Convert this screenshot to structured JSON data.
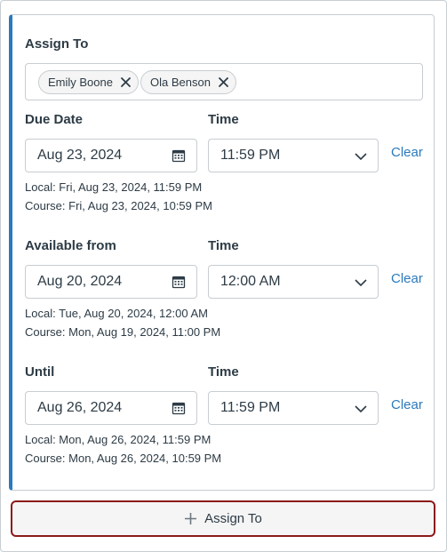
{
  "assign": {
    "label": "Assign To",
    "assignees": [
      {
        "name": "Emily Boone"
      },
      {
        "name": "Ola Benson"
      }
    ]
  },
  "due": {
    "label": "Due Date",
    "time_label": "Time",
    "date": "Aug 23, 2024",
    "time": "11:59 PM",
    "clear": "Clear",
    "local": "Local: Fri, Aug 23, 2024, 11:59 PM",
    "course": "Course: Fri, Aug 23, 2024, 10:59 PM"
  },
  "available": {
    "label": "Available from",
    "time_label": "Time",
    "date": "Aug 20, 2024",
    "time": "12:00 AM",
    "clear": "Clear",
    "local": "Local: Tue, Aug 20, 2024, 12:00 AM",
    "course": "Course: Mon, Aug 19, 2024, 11:00 PM"
  },
  "until": {
    "label": "Until",
    "time_label": "Time",
    "date": "Aug 26, 2024",
    "time": "11:59 PM",
    "clear": "Clear",
    "local": "Local: Mon, Aug 26, 2024, 11:59 PM",
    "course": "Course: Mon, Aug 26, 2024, 10:59 PM"
  },
  "add_button": {
    "label": "Assign To"
  },
  "colors": {
    "accent": "#2b7abc",
    "focus_outline": "#8b1a1a",
    "text": "#2d3b45",
    "border": "#c7cdd1"
  }
}
